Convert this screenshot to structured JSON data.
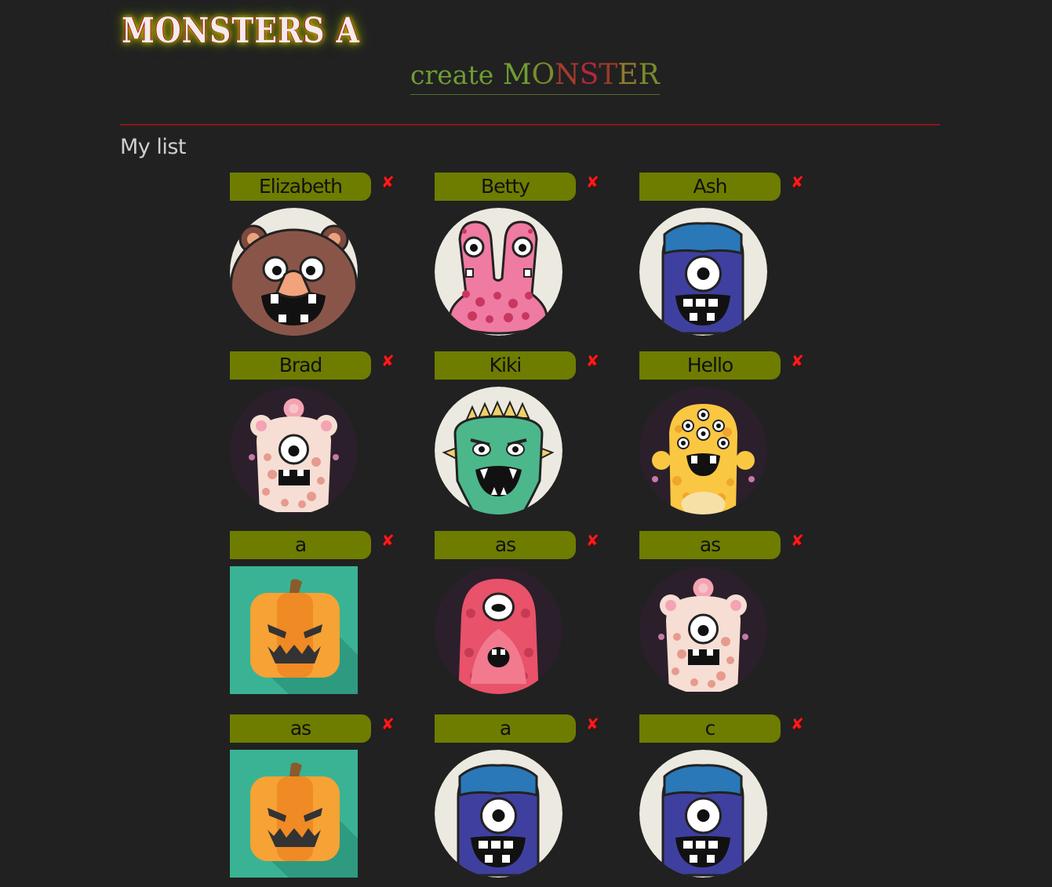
{
  "header": {
    "logo_text": "MONSTERS A",
    "create_link": {
      "word1": "create",
      "word2_letters": [
        "M",
        "O",
        "N",
        "S",
        "T",
        "E",
        "R"
      ]
    }
  },
  "section": {
    "title": "My list"
  },
  "monsters": [
    {
      "name": "Elizabeth",
      "avatar": "bear-monster",
      "delete": "✘"
    },
    {
      "name": "Betty",
      "avatar": "pink-two-eyed-monster",
      "delete": "✘"
    },
    {
      "name": "Ash",
      "avatar": "blue-cyclops-monster",
      "delete": "✘"
    },
    {
      "name": "Brad",
      "avatar": "flower-cyclops-monster",
      "delete": "✘"
    },
    {
      "name": "Kiki",
      "avatar": "green-spiky-monster",
      "delete": "✘"
    },
    {
      "name": "Hello",
      "avatar": "yellow-multi-eye-monster",
      "delete": "✘"
    },
    {
      "name": "a",
      "avatar": "pumpkin",
      "delete": "✘"
    },
    {
      "name": "as",
      "avatar": "red-tentacle-monster",
      "delete": "✘"
    },
    {
      "name": "as",
      "avatar": "flower-cyclops-monster",
      "delete": "✘"
    },
    {
      "name": "as",
      "avatar": "pumpkin",
      "delete": "✘"
    },
    {
      "name": "a",
      "avatar": "blue-cyclops-monster",
      "delete": "✘"
    },
    {
      "name": "c",
      "avatar": "blue-cyclops-monster",
      "delete": "✘"
    }
  ],
  "colors": {
    "background": "#212121",
    "name_tag": "#6e7d00",
    "divider": "#8c1818",
    "delete": "#ff1a1a"
  }
}
